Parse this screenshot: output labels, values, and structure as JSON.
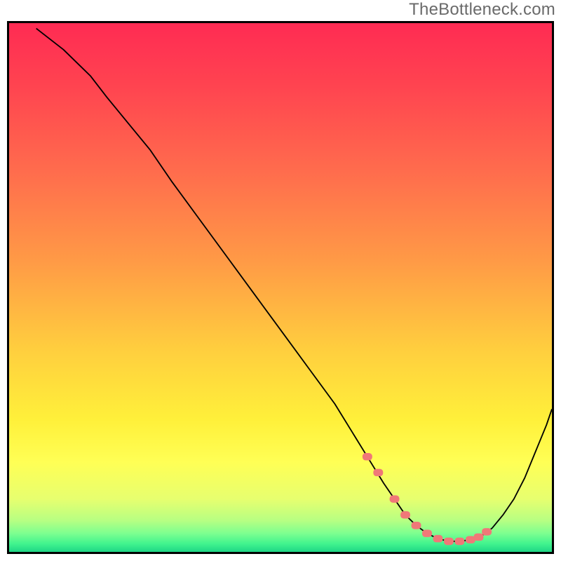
{
  "watermark": "TheBottleneck.com",
  "colors": {
    "curve": "#000000",
    "marker": "#f07878",
    "border": "#000000"
  },
  "chart_data": {
    "type": "line",
    "title": "",
    "xlabel": "",
    "ylabel": "",
    "xlim": [
      0,
      100
    ],
    "ylim": [
      0,
      100
    ],
    "grid": false,
    "legend": false,
    "description": "V-shaped bottleneck curve on a red-to-green vertical gradient. Line starts near the top-left, plunges to a flat minimum around x 70-85, then rises again toward the right edge. Salmon-colored markers highlight points along the flat bottom of the valley.",
    "series": [
      {
        "name": "bottleneck-curve",
        "x": [
          5,
          10,
          15,
          18,
          22,
          26,
          30,
          35,
          40,
          45,
          50,
          55,
          60,
          63,
          66,
          69,
          71,
          73,
          75,
          77,
          79,
          81,
          83,
          85,
          87,
          89,
          91,
          93,
          95,
          97,
          99,
          100
        ],
        "y": [
          99,
          95,
          90,
          86,
          81,
          76,
          70,
          63,
          56,
          49,
          42,
          35,
          28,
          23,
          18,
          13,
          10,
          7,
          5,
          3.5,
          2.5,
          2,
          2,
          2.3,
          3,
          4.5,
          7,
          10,
          14,
          19,
          24,
          27
        ]
      }
    ],
    "markers": {
      "name": "valley-markers",
      "x": [
        66,
        68,
        71,
        73,
        75,
        77,
        79,
        81,
        83,
        85,
        86.5,
        88
      ],
      "y": [
        18,
        15,
        10,
        7,
        5,
        3.5,
        2.5,
        2,
        2,
        2.3,
        2.8,
        3.8
      ],
      "size": 10
    }
  }
}
